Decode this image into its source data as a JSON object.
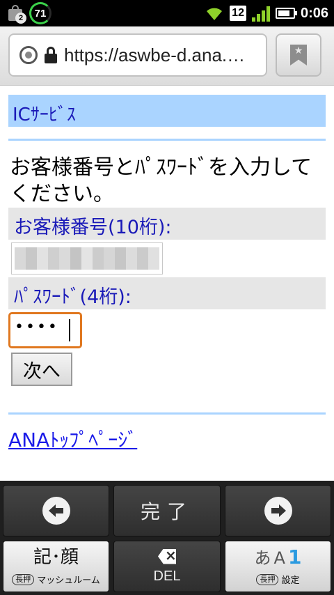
{
  "status_bar": {
    "notification_count": "2",
    "battery_ring_value": "71",
    "sim_number": "12",
    "clock": "0:06",
    "signal_color": "#8fd12a",
    "ring_color": "#3bd14a"
  },
  "browser": {
    "url": "https://aswbe-d.ana.…",
    "bookmark_icon": "bookmark-star-icon"
  },
  "page": {
    "section_header": "ICｻｰﾋﾞｽ",
    "instruction": "お客様番号とﾊﾟｽﾜｰﾄﾞを入力してください。",
    "customer_number_label": "お客様番号(10桁):",
    "password_label": "ﾊﾟｽﾜｰﾄﾞ(4桁):",
    "password_dots": "••••",
    "next_button": "次へ",
    "top_link": "ANAﾄｯﾌﾟﾍﾟｰｼﾞ",
    "header_color": "#aad4ff",
    "focus_color": "#e07820"
  },
  "keyboard": {
    "done": "完了",
    "left_arrow_icon": "left-arrow-icon",
    "right_arrow_icon": "right-arrow-icon",
    "kaomoji_main": "記･顔",
    "kaomoji_pill": "長押",
    "kaomoji_sub": "マッシュルーム",
    "del": "DEL",
    "settings_a": "あ",
    "settings_b": "A",
    "settings_c": "1",
    "settings_pill": "長押",
    "settings_sub": "設定"
  }
}
